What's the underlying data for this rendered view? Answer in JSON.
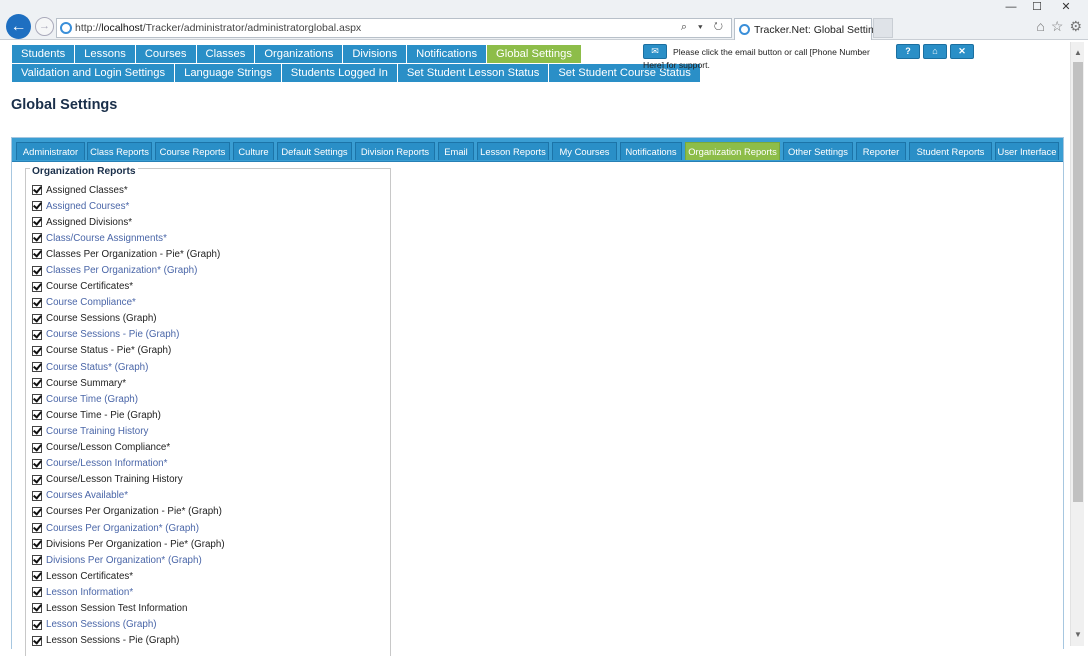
{
  "browser": {
    "url_prefix": "http://",
    "url_host": "localhost",
    "url_path": "/Tracker/administrator/administratorglobal.aspx",
    "tab_title": "Tracker.Net: Global Settings",
    "window_minimize": "—",
    "window_maximize": "☐",
    "window_close": "✕",
    "address_tools": "⌕ ▾ ↻",
    "home_icon": "⌂",
    "favorites_icon": "☆",
    "settings_icon": "⚙"
  },
  "menu": {
    "row1": [
      {
        "label": "Students",
        "active": false
      },
      {
        "label": "Lessons",
        "active": false
      },
      {
        "label": "Courses",
        "active": false
      },
      {
        "label": "Classes",
        "active": false
      },
      {
        "label": "Organizations",
        "active": false
      },
      {
        "label": "Divisions",
        "active": false
      },
      {
        "label": "Notifications",
        "active": false
      },
      {
        "label": "Global Settings",
        "active": true
      }
    ],
    "row2": [
      {
        "label": "Validation and Login Settings"
      },
      {
        "label": "Language Strings"
      },
      {
        "label": "Students Logged In"
      },
      {
        "label": "Set Student Lesson Status"
      },
      {
        "label": "Set Student Course Status"
      }
    ]
  },
  "support": {
    "text": "Please click the email button or call [Phone Number Here] for support.",
    "mail_icon": "✉",
    "help_label": "?",
    "home_label": "⌂",
    "close_label": "✕"
  },
  "page": {
    "title": "Global Settings"
  },
  "settings_tabs": [
    {
      "label": "Administrator",
      "active": false
    },
    {
      "label": "Class Reports",
      "active": false
    },
    {
      "label": "Course Reports",
      "active": false
    },
    {
      "label": "Culture",
      "active": false
    },
    {
      "label": "Default Settings",
      "active": false
    },
    {
      "label": "Division Reports",
      "active": false
    },
    {
      "label": "Email",
      "active": false
    },
    {
      "label": "Lesson Reports",
      "active": false
    },
    {
      "label": "My Courses",
      "active": false
    },
    {
      "label": "Notifications",
      "active": false
    },
    {
      "label": "Organization Reports",
      "active": true
    },
    {
      "label": "Other Settings",
      "active": false
    },
    {
      "label": "Reporter",
      "active": false
    },
    {
      "label": "Student Reports",
      "active": false
    },
    {
      "label": "User Interface",
      "active": false
    }
  ],
  "organization_reports": {
    "legend": "Organization Reports",
    "items": [
      {
        "label": "Assigned Classes*",
        "checked": true,
        "style": "dark"
      },
      {
        "label": "Assigned Courses*",
        "checked": true,
        "style": "blue"
      },
      {
        "label": "Assigned Divisions*",
        "checked": true,
        "style": "dark"
      },
      {
        "label": "Class/Course Assignments*",
        "checked": true,
        "style": "blue"
      },
      {
        "label": "Classes Per Organization - Pie* (Graph)",
        "checked": true,
        "style": "dark"
      },
      {
        "label": "Classes Per Organization* (Graph)",
        "checked": true,
        "style": "blue"
      },
      {
        "label": "Course Certificates*",
        "checked": true,
        "style": "dark"
      },
      {
        "label": "Course Compliance*",
        "checked": true,
        "style": "blue"
      },
      {
        "label": "Course Sessions (Graph)",
        "checked": true,
        "style": "dark"
      },
      {
        "label": "Course Sessions - Pie (Graph)",
        "checked": true,
        "style": "blue"
      },
      {
        "label": "Course Status - Pie* (Graph)",
        "checked": true,
        "style": "dark"
      },
      {
        "label": "Course Status* (Graph)",
        "checked": true,
        "style": "blue"
      },
      {
        "label": "Course Summary*",
        "checked": true,
        "style": "dark"
      },
      {
        "label": "Course Time (Graph)",
        "checked": true,
        "style": "blue"
      },
      {
        "label": "Course Time - Pie (Graph)",
        "checked": true,
        "style": "dark"
      },
      {
        "label": "Course Training History",
        "checked": true,
        "style": "blue"
      },
      {
        "label": "Course/Lesson Compliance*",
        "checked": true,
        "style": "dark"
      },
      {
        "label": "Course/Lesson Information*",
        "checked": true,
        "style": "blue"
      },
      {
        "label": "Course/Lesson Training History",
        "checked": true,
        "style": "dark"
      },
      {
        "label": "Courses Available*",
        "checked": true,
        "style": "blue"
      },
      {
        "label": "Courses Per Organization - Pie* (Graph)",
        "checked": true,
        "style": "dark"
      },
      {
        "label": "Courses Per Organization* (Graph)",
        "checked": true,
        "style": "blue"
      },
      {
        "label": "Divisions Per Organization - Pie* (Graph)",
        "checked": true,
        "style": "dark"
      },
      {
        "label": "Divisions Per Organization* (Graph)",
        "checked": true,
        "style": "blue"
      },
      {
        "label": "Lesson Certificates*",
        "checked": true,
        "style": "dark"
      },
      {
        "label": "Lesson Information*",
        "checked": true,
        "style": "blue"
      },
      {
        "label": "Lesson Session Test Information",
        "checked": true,
        "style": "dark"
      },
      {
        "label": "Lesson Sessions (Graph)",
        "checked": true,
        "style": "blue"
      },
      {
        "label": "Lesson Sessions - Pie (Graph)",
        "checked": true,
        "style": "dark"
      }
    ]
  }
}
